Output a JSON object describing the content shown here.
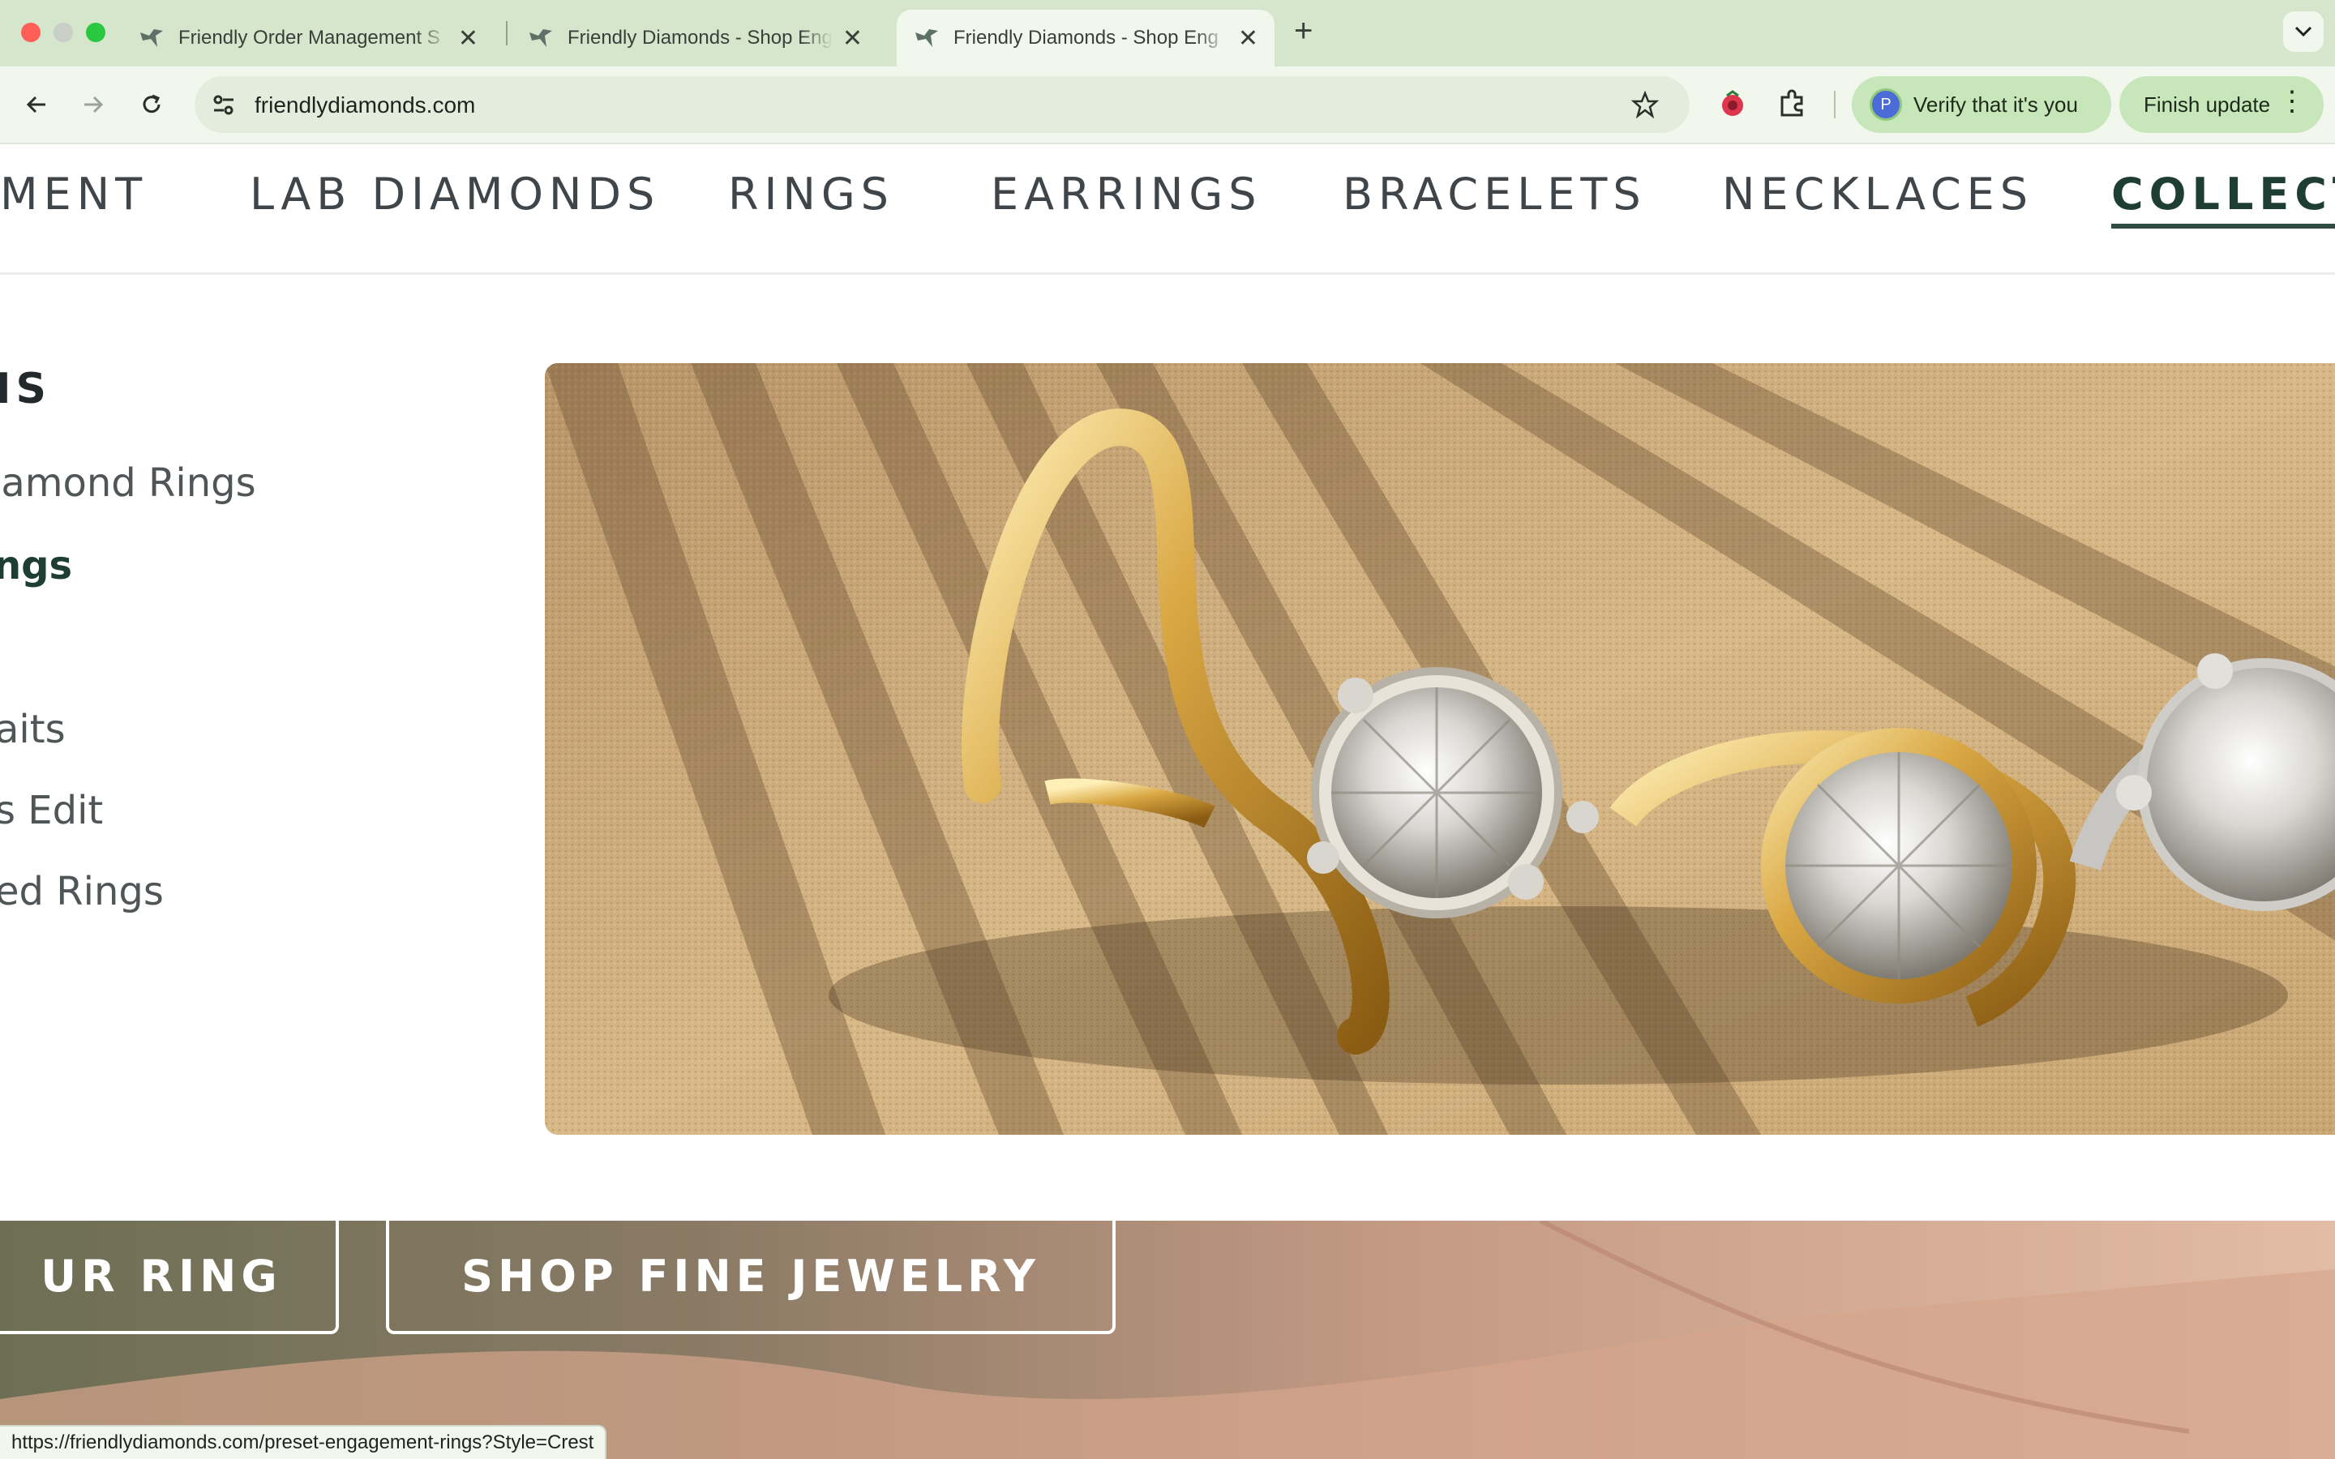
{
  "browser": {
    "tabs": [
      {
        "title": "Friendly Order Management S",
        "active": false
      },
      {
        "title": "Friendly Diamonds - Shop Eng",
        "active": false
      },
      {
        "title": "Friendly Diamonds - Shop Eng",
        "active": true
      }
    ],
    "url": "friendlydiamonds.com",
    "verify_label": "Verify that it's you",
    "avatar_letter": "P",
    "finish_update_label": "Finish update",
    "status_url": "https://friendlydiamonds.com/preset-engagement-rings?Style=Crest"
  },
  "site_nav": {
    "items": [
      {
        "label": "MENT"
      },
      {
        "label": "LAB DIAMONDS"
      },
      {
        "label": "RINGS"
      },
      {
        "label": "EARRINGS"
      },
      {
        "label": "BRACELETS"
      },
      {
        "label": "NECKLACES"
      },
      {
        "label": "COLLECTI",
        "active": true
      }
    ]
  },
  "collections_menu": {
    "heading": "NS",
    "items": [
      {
        "label": "iamond Rings"
      },
      {
        "label": "ngs",
        "active": true
      },
      {
        "label": "aits"
      },
      {
        "label": "s Edit"
      },
      {
        "label": "ed Rings"
      }
    ]
  },
  "hero_image": {
    "alt": "Gold diamond rings on sand"
  },
  "cta": {
    "left_label": "UR RING",
    "shop_fine_jewelry_label": "SHOP FINE JEWELRY"
  },
  "colors": {
    "tabstrip": "#d6e6cc",
    "toolbar": "#f2f7ee",
    "brand_green": "#1e3d33",
    "update_chip": "#c7e6b9"
  }
}
